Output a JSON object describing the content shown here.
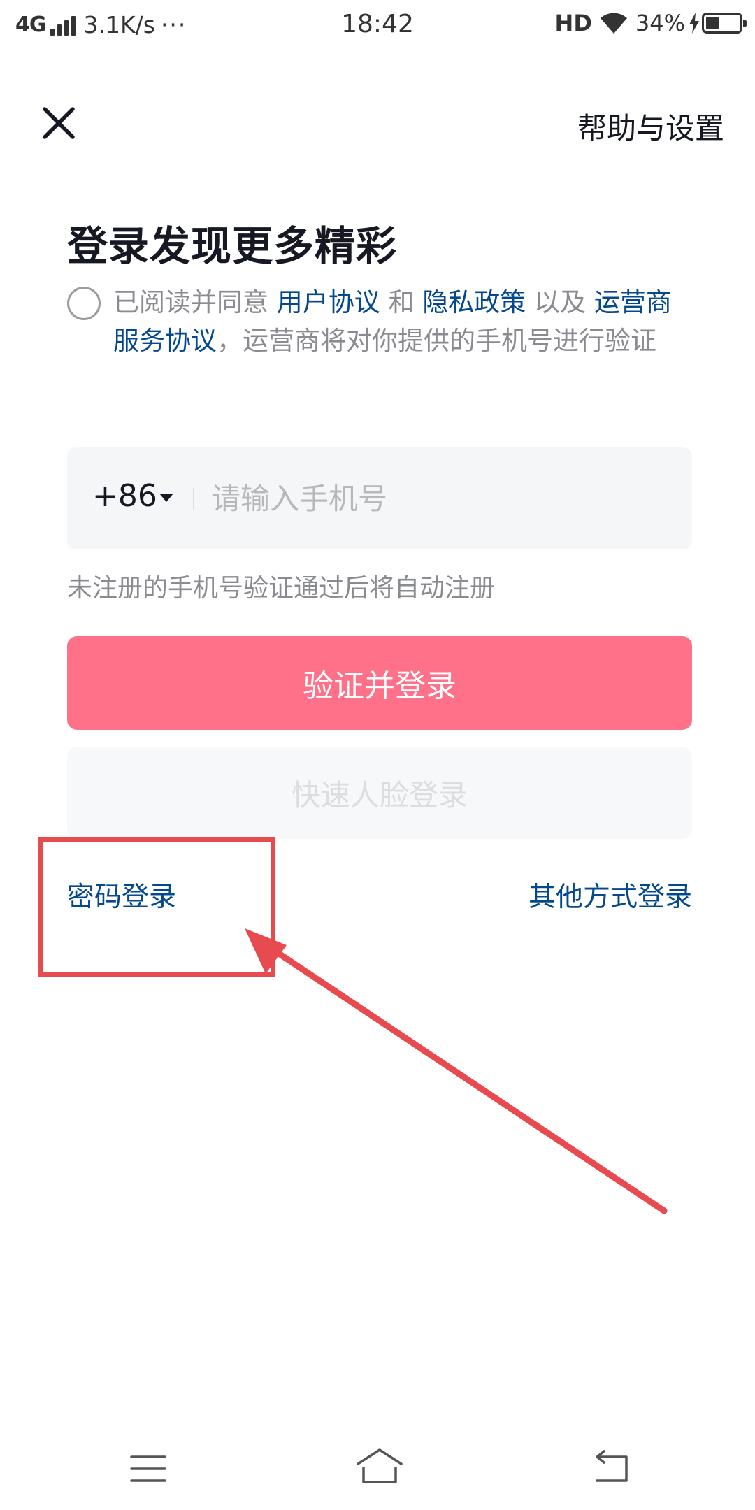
{
  "status_bar": {
    "network": "4G",
    "speed": "3.1K/s",
    "more": "···",
    "time": "18:42",
    "hd": "HD",
    "battery": "34%",
    "battery_level": 0.34
  },
  "header": {
    "close_icon": "close-icon",
    "help_label": "帮助与设置"
  },
  "title": "登录发现更多精彩",
  "agreement": {
    "prefix": "已阅读并同意 ",
    "user_agreement": "用户协议",
    "and": " 和 ",
    "privacy_policy": "隐私政策",
    "also": " 以及 ",
    "carrier_agreement": "运营商服务协议",
    "suffix": "，运营商将对你提供的手机号进行验证"
  },
  "phone": {
    "country_code": "+86",
    "placeholder": "请输入手机号",
    "value": ""
  },
  "hint": "未注册的手机号验证通过后将自动注册",
  "buttons": {
    "verify_login": "验证并登录",
    "face_login": "快速人脸登录"
  },
  "links": {
    "password_login": "密码登录",
    "other_login": "其他方式登录"
  },
  "colors": {
    "primary": "#fe7189",
    "link": "#04498d",
    "annotation": "#e84b4f"
  },
  "nav_bar": {
    "menu_icon": "menu-icon",
    "home_icon": "home-icon",
    "back_icon": "back-icon"
  }
}
